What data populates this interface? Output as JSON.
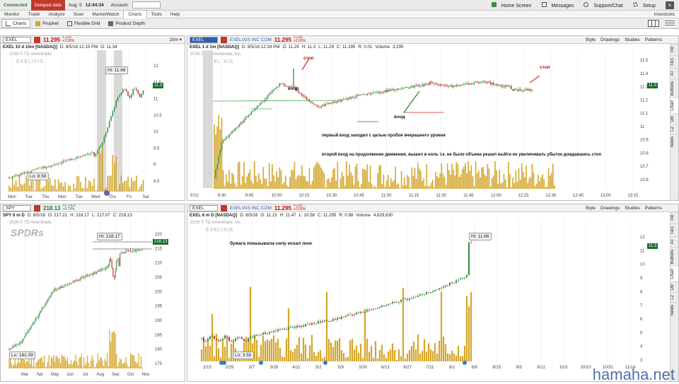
{
  "status": {
    "connected": "Connected",
    "delayed": "Delayed data",
    "date": "Aug. 5",
    "time": "12:44:34",
    "account": "Account:"
  },
  "topbar": {
    "home": "Home Screen",
    "messages": "Messages",
    "support": "Support/Chat",
    "setup": "Setup"
  },
  "nav": {
    "tabs": [
      "Monitor",
      "Trade",
      "Analyze",
      "Scan",
      "MarketWatch",
      "Charts",
      "Tools",
      "Help"
    ],
    "active": "Charts",
    "right": "Investools"
  },
  "subnav": {
    "items": [
      "Charts",
      "Prophet",
      "Flexible Grid",
      "Product Depth"
    ]
  },
  "side_tabs": [
    "Trd",
    "T&S",
    "AT",
    "Buttons",
    "Chart",
    "DB",
    "L2",
    "News"
  ],
  "panels": {
    "p1": {
      "symbol": "EXEL",
      "price": "11.295",
      "chg1": "+.225",
      "chg2": "+2.03%",
      "title": "EXEL 10 d 15m [NASDAQ]",
      "info": [
        "D: 8/5/16 12:15 PM",
        "O: 11.34"
      ],
      "copyright": "2016 © TD Ameritrade",
      "logo": "EXELIXIS",
      "hi": "Hi: 11.66",
      "lo": "Lo: 8.58",
      "event": "$-0.16",
      "price_tag": "11.3",
      "yaxis": [
        "12",
        "11.5",
        "11",
        "10.5",
        "10",
        "9.5",
        "9",
        "8.5"
      ],
      "xaxis": [
        "Mon",
        "Tue",
        "Thu",
        "Mon",
        "Tue",
        "Wed",
        "Thu",
        "Fri",
        "Sat"
      ]
    },
    "p2": {
      "symbol": "EXEL",
      "company": "EXELIXIS INC COM",
      "price": "11.295",
      "chg1": "+.225",
      "chg2": "+2.03%",
      "title": "EXEL 1 d 1m [NASDAQ]",
      "info": [
        "D: 8/5/16 12:24 PM",
        "O: 11.29",
        "H: 11.3",
        "L: 11.29",
        "C: 11.295",
        "R: 0.01",
        "Volume",
        "3,295"
      ],
      "copyright": "2016 © TD Ameritrade, Inc.",
      "logo": "EXELIXIS",
      "price_tag": "11.3",
      "yaxis": [
        "11.5",
        "11.4",
        "11.3",
        "11.2",
        "11.1",
        "11",
        "10.9",
        "10.8",
        "10.7",
        "10.6"
      ],
      "xaxis": [
        "9:02",
        "9:30",
        "9:45",
        "10:00",
        "10:15",
        "10:30",
        "10:45",
        "11:00",
        "11:15",
        "11:30",
        "11:45",
        "12:00",
        "12:15",
        "12:30",
        "12:45",
        "13:00",
        "13:15"
      ],
      "annotations": {
        "stop1": "стоп",
        "entry1": "вход",
        "entry2": "вход",
        "stop2": "стоп",
        "text1": "первый вход заходил с целью пробоя вчерашнего уровня",
        "text2": "второй вход на продолжение движения, вышел в ноль т.к. не было объема решил выйти не увеличивать убыток дождавшись стоп"
      },
      "toolbar": [
        "Style",
        "Drawings",
        "Studies",
        "Patterns"
      ]
    },
    "p3": {
      "symbol": "SPY",
      "price": "218.13",
      "chg1": "+1.7003",
      "chg2": "+0.79%",
      "title": "SPY 6 m D",
      "info": [
        "D: 8/5/16",
        "O: 217.21",
        "H: 218.17",
        "L: 217.07",
        "C: 218.13"
      ],
      "copyright": "2016 © TD Ameritrade",
      "logo": "SPDRs",
      "hi": "Hi: 218.17",
      "lo": "Lo: 181.09",
      "event": "$-0.16",
      "price_tag": "218.13",
      "yaxis": [
        "220",
        "215",
        "210",
        "205",
        "200",
        "195",
        "190",
        "185",
        "180",
        "175"
      ],
      "xaxis": [
        "Mar",
        "Apr",
        "May",
        "Jun",
        "Jul",
        "Aug",
        "Sep",
        "Oct",
        "Nov"
      ]
    },
    "p4": {
      "symbol": "EXEL",
      "company": "EXELIXIS INC COM",
      "price": "11.295",
      "chg1": "+.225",
      "chg2": "+2.03%",
      "title": "EXEL 6 m D [NASDAQ]",
      "info": [
        "D: 8/5/16",
        "O: 11.15",
        "H: 11.47",
        "L: 10.58",
        "C: 11.295",
        "R: 0.88",
        "Volume",
        "4,829,630"
      ],
      "copyright": "2016 © TD Ameritrade, Inc.",
      "logo": "EXELIXIS",
      "hi": "Hi: 11.66",
      "lo": "Lo: 3.55",
      "event": "$-0.16",
      "event2": "$-0.27",
      "price_tag": "11.3",
      "annotation": "бумага показывала силу искал лонг",
      "yaxis": [
        "12",
        "11",
        "10",
        "9",
        "8",
        "7",
        "6",
        "5",
        "4",
        "3"
      ],
      "xaxis": [
        "2/15",
        "2/29",
        "3/7",
        "3/28",
        "4/11",
        "5/2",
        "5/9",
        "5/30",
        "6/13",
        "6/27",
        "7/11",
        "8/1",
        "8/8",
        "8/15",
        "9/5",
        "9/12",
        "10/3",
        "10/10",
        "10/31",
        "11/14"
      ],
      "toolbar": [
        "Style",
        "Drawings",
        "Studies",
        "Patterns"
      ]
    }
  },
  "watermark": "hamaha.net",
  "colors": {
    "up": "#2e8b3a",
    "down": "#c62828",
    "volume": "#d4a62a",
    "bg_session": "#d9d9d9",
    "price_tag": "#1a6b2f"
  }
}
